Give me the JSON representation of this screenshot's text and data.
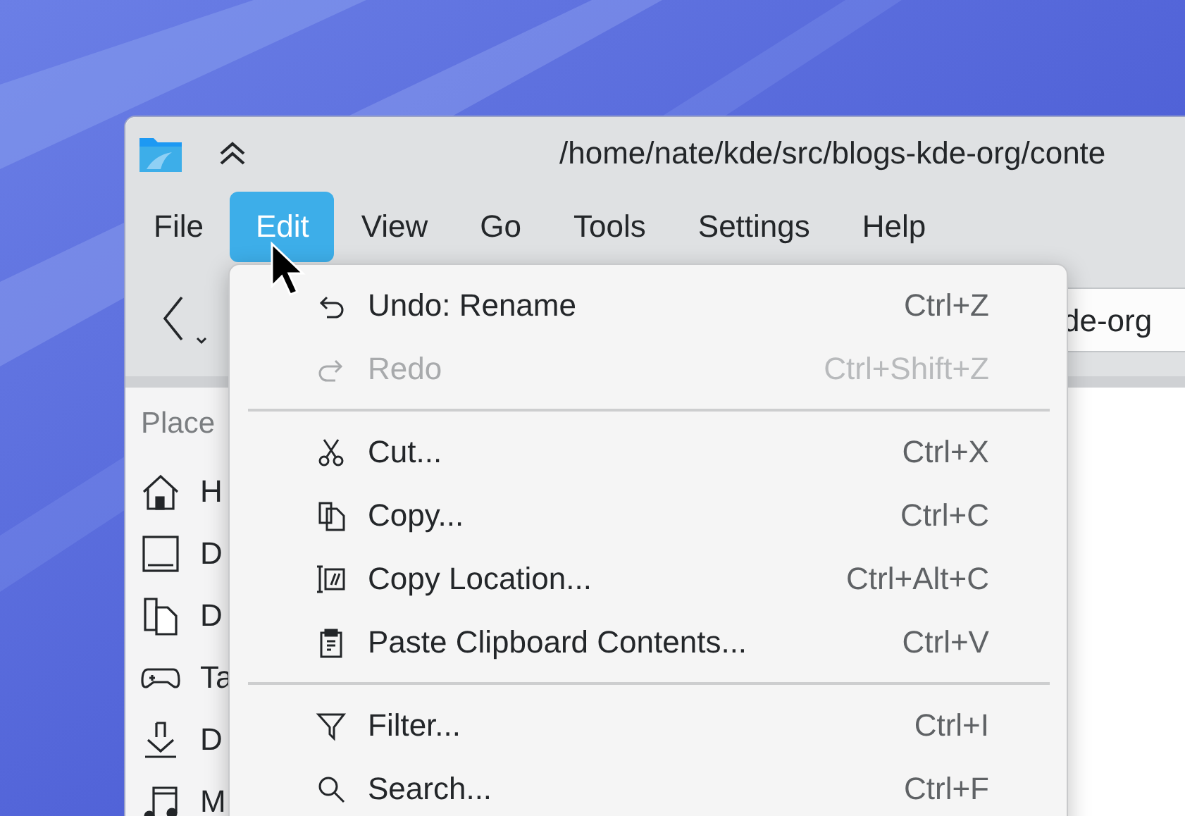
{
  "window": {
    "title": "/home/nate/kde/src/blogs-kde-org/conte"
  },
  "menu_bar": [
    {
      "label": "File",
      "selected": false
    },
    {
      "label": "Edit",
      "selected": true
    },
    {
      "label": "View",
      "selected": false
    },
    {
      "label": "Go",
      "selected": false
    },
    {
      "label": "Tools",
      "selected": false
    },
    {
      "label": "Settings",
      "selected": false
    },
    {
      "label": "Help",
      "selected": false
    }
  ],
  "toolbar": {
    "location": "de-org"
  },
  "sidebar": {
    "heading": "Place",
    "items": [
      {
        "kind": "home",
        "label": "H"
      },
      {
        "kind": "desktop",
        "label": "D"
      },
      {
        "kind": "documents",
        "label": "D"
      },
      {
        "kind": "games",
        "label": "Ta"
      },
      {
        "kind": "downloads",
        "label": "D"
      },
      {
        "kind": "music",
        "label": "M"
      }
    ]
  },
  "edit_menu": {
    "items": [
      {
        "kind": "undo",
        "label": "Undo: Rename",
        "shortcut": "Ctrl+Z",
        "disabled": false
      },
      {
        "kind": "redo",
        "label": "Redo",
        "shortcut": "Ctrl+Shift+Z",
        "disabled": true
      },
      {
        "kind": "separator"
      },
      {
        "kind": "cut",
        "label": "Cut...",
        "shortcut": "Ctrl+X",
        "disabled": false
      },
      {
        "kind": "copy",
        "label": "Copy...",
        "shortcut": "Ctrl+C",
        "disabled": false
      },
      {
        "kind": "copy-location",
        "label": "Copy Location...",
        "shortcut": "Ctrl+Alt+C",
        "disabled": false
      },
      {
        "kind": "paste",
        "label": "Paste Clipboard Contents...",
        "shortcut": "Ctrl+V",
        "disabled": false
      },
      {
        "kind": "separator"
      },
      {
        "kind": "filter",
        "label": "Filter...",
        "shortcut": "Ctrl+I",
        "disabled": false
      },
      {
        "kind": "search",
        "label": "Search...",
        "shortcut": "Ctrl+F",
        "disabled": false
      }
    ]
  }
}
